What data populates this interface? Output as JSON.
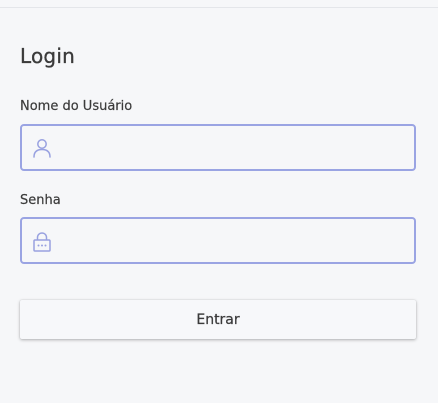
{
  "colors": {
    "background": "#f6f7f9",
    "input_border": "#9aa4e3",
    "icon": "#98a1e0",
    "text": "#3b3b3b"
  },
  "form": {
    "title": "Login",
    "username": {
      "label": "Nome do Usuário",
      "value": "",
      "icon": "user-icon"
    },
    "password": {
      "label": "Senha",
      "value": "",
      "icon": "lock-icon"
    },
    "submit_label": "Entrar"
  }
}
